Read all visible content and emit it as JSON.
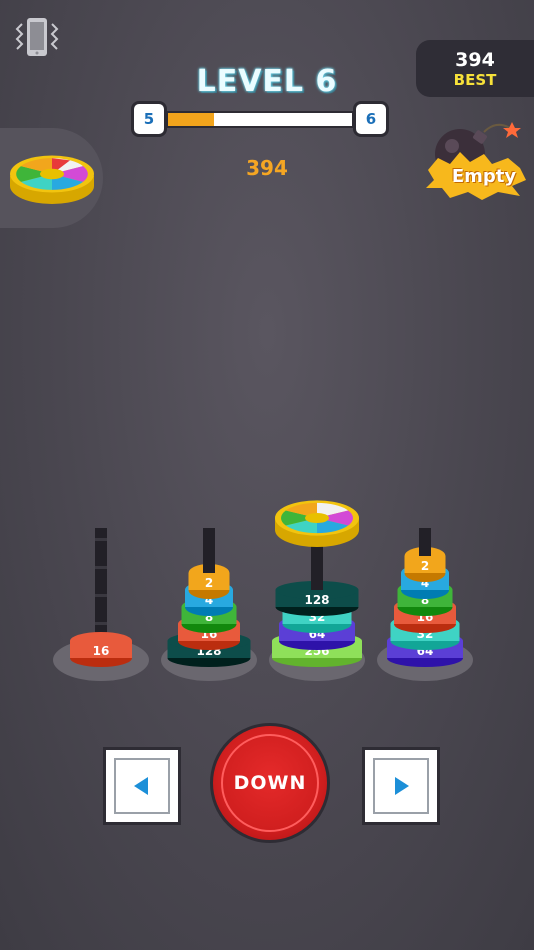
{
  "header": {
    "level_title": "LEVEL 6",
    "level_from": "5",
    "level_to": "6",
    "progress": 0.25,
    "score": "394",
    "best_value": "394",
    "best_label": "BEST"
  },
  "powerups": {
    "bomb_label": "Empty",
    "wheel_icon": "color-wheel-icon",
    "bomb_icon": "bomb-icon",
    "vibrate_icon": "vibrate-icon"
  },
  "pegs": [
    {
      "rings": [
        "16"
      ]
    },
    {
      "rings": [
        "128",
        "16",
        "8",
        "4",
        "2"
      ]
    },
    {
      "rings": [
        "256",
        "64",
        "32",
        "128"
      ]
    },
    {
      "rings": [
        "64",
        "32",
        "16",
        "8",
        "4",
        "2"
      ]
    }
  ],
  "held_piece": "color-wheel",
  "controls": {
    "down_label": "DOWN",
    "left_icon": "left-arrow-icon",
    "right_icon": "right-arrow-icon"
  },
  "colors": {
    "accent": "#f2a41c",
    "best": "#f7e13a",
    "down_button": "#d11f1f",
    "ring_2": "#f2a61c",
    "ring_4": "#28a9e0",
    "ring_8": "#3fb53a",
    "ring_16": "#e85a3c",
    "ring_32": "#3fd3c4",
    "ring_64": "#5b3fd6",
    "ring_128": "#0d4d4a",
    "ring_256": "#8fe05a"
  }
}
